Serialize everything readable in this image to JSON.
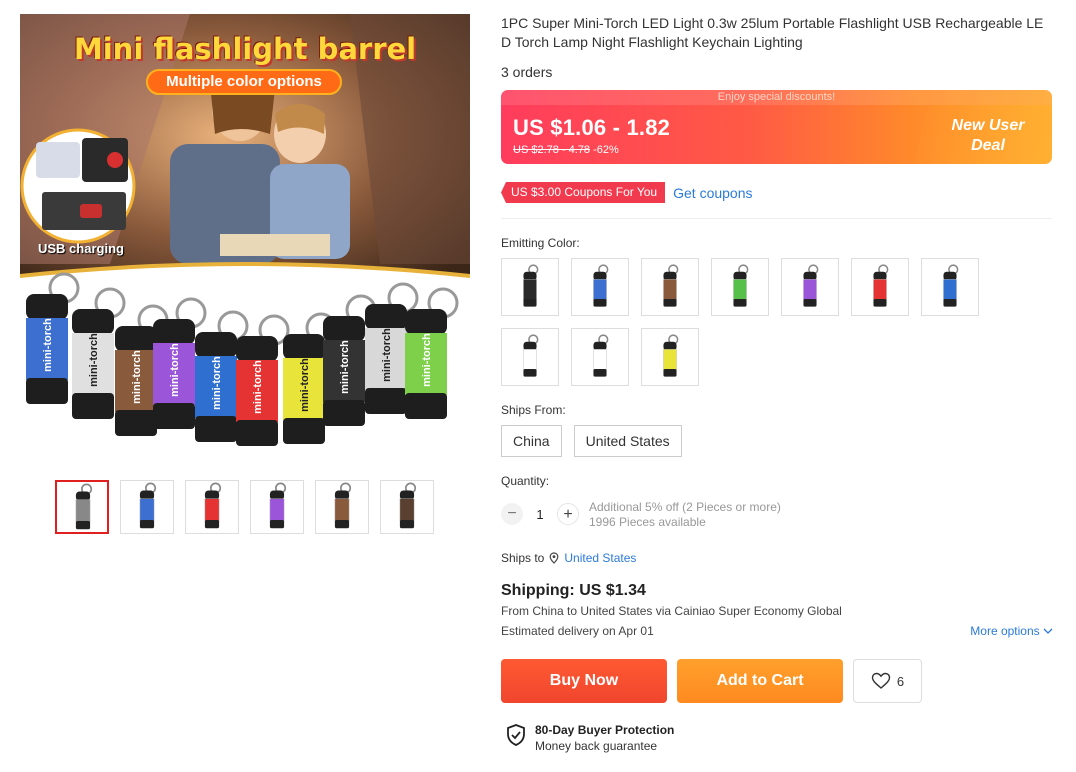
{
  "gallery": {
    "promo_title": "Mini flashlight barrel",
    "promo_subtitle": "Multiple color options",
    "usb_label": "USB charging",
    "torch_brand": "mini-torch",
    "torch_colors": [
      "#3d6fd0",
      "#e0e0e0",
      "#8a5a3c",
      "#9b55d8",
      "#2f6fd0",
      "#e53232",
      "#e8e43a",
      "#333333",
      "#d8d8d8",
      "#7ed04a"
    ],
    "thumbnails": [
      {
        "name": "thumb-1",
        "color": "#888888",
        "active": true
      },
      {
        "name": "thumb-2",
        "color": "#3d6fd0",
        "active": false
      },
      {
        "name": "thumb-3",
        "color": "#e53232",
        "active": false
      },
      {
        "name": "thumb-4",
        "color": "#9b55d8",
        "active": false
      },
      {
        "name": "thumb-5",
        "color": "#8a5a3c",
        "active": false
      },
      {
        "name": "thumb-6",
        "color": "#5a4030",
        "active": false
      }
    ]
  },
  "product": {
    "title": "1PC Super Mini-Torch LED Light 0.3w 25lum Portable Flashlight USB Rechargeable LED Torch Lamp Night Flashlight Keychain Lighting",
    "orders": "3 orders"
  },
  "price": {
    "banner": "Enjoy special discounts!",
    "current": "US $1.06 - 1.82",
    "original": "US $2.78 - 4.78",
    "discount": "-62%",
    "deal_line1": "New User",
    "deal_line2": "Deal"
  },
  "coupon": {
    "tag": "US $3.00 Coupons For You",
    "link": "Get coupons"
  },
  "color_label": "Emitting Color:",
  "colors": [
    "#2a2a2a",
    "#3d6fd0",
    "#8a5a3c",
    "#57c04a",
    "#9b55d8",
    "#e53232",
    "#2f6fd0",
    "#ffffff",
    "#ffffff",
    "#e8e43a"
  ],
  "ships_from": {
    "label": "Ships From:",
    "options": [
      "China",
      "United States"
    ]
  },
  "quantity": {
    "label": "Quantity:",
    "minus": "−",
    "value": "1",
    "plus": "+",
    "promo": "Additional 5% off (2 Pieces or more)",
    "available": "1996 Pieces available"
  },
  "shipping": {
    "ships_to_label": "Ships to",
    "ships_to": "United States",
    "cost": "Shipping: US $1.34",
    "route": "From China to United States via Cainiao Super Economy Global",
    "eta": "Estimated delivery on Apr 01",
    "more": "More options"
  },
  "actions": {
    "buy": "Buy Now",
    "cart": "Add to Cart",
    "wish_count": "6"
  },
  "protection": {
    "title": "80-Day Buyer Protection",
    "subtitle": "Money back guarantee"
  }
}
